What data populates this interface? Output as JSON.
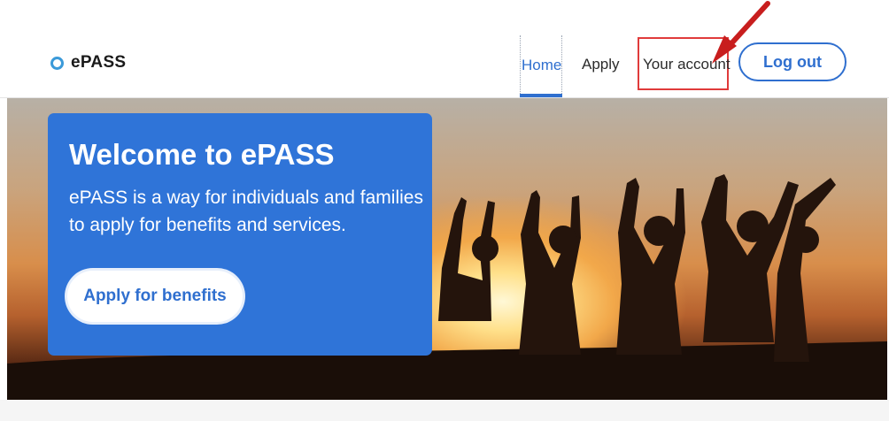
{
  "brand": {
    "name": "ePASS"
  },
  "nav": {
    "home": "Home",
    "apply": "Apply",
    "account": "Your account",
    "logout": "Log out"
  },
  "hero": {
    "title": "Welcome to ePASS",
    "description": "ePASS is a way for individuals and families to apply for benefits and services.",
    "cta": "Apply for benefits"
  },
  "colors": {
    "primary": "#2f74d8",
    "highlight": "#e03b3b",
    "arrow": "#c81e1e"
  },
  "icons": {
    "logo": "ring-icon",
    "annotation": "arrow-icon"
  }
}
